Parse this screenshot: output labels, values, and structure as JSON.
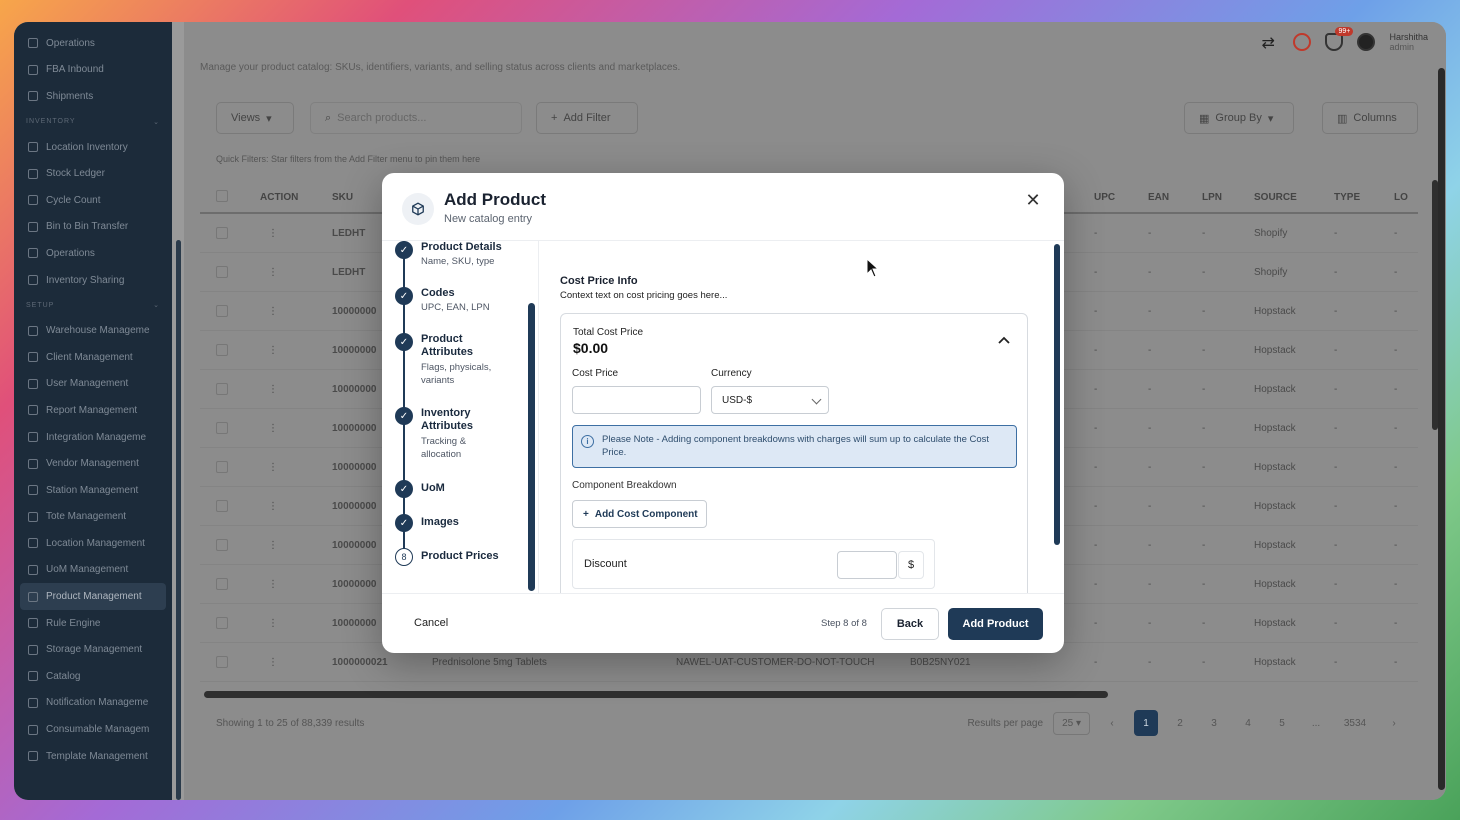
{
  "sidebar": {
    "items_top": [
      "Operations",
      "FBA Inbound",
      "Shipments"
    ],
    "section_inventory": "INVENTORY",
    "items_inventory": [
      "Location Inventory",
      "Stock Ledger",
      "Cycle Count",
      "Bin to Bin Transfer",
      "Operations",
      "Inventory Sharing"
    ],
    "section_setup": "SETUP",
    "items_setup": [
      "Warehouse Manageme",
      "Client Management",
      "User Management",
      "Report Management",
      "Integration Manageme",
      "Vendor Management",
      "Station Management",
      "Tote Management",
      "Location Management",
      "UoM Management",
      "Product Management",
      "Rule Engine",
      "Storage Management",
      "Catalog",
      "Notification Manageme",
      "Consumable Managem",
      "Template Management"
    ]
  },
  "topbar": {
    "user_name": "Harshitha",
    "user_role": "admin",
    "notif_count": "99+"
  },
  "page": {
    "subtitle": "Manage your product catalog: SKUs, identifiers, variants, and selling status across clients and marketplaces.",
    "views_label": "Views",
    "search_placeholder": "Search products...",
    "add_filter_label": "Add Filter",
    "group_by_label": "Group By",
    "columns_label": "Columns",
    "quick_filters": "Quick Filters:  Star filters from the Add Filter menu to pin them here",
    "columns": [
      "ACTION",
      "SKU",
      "UPC",
      "EAN",
      "LPN",
      "SOURCE",
      "TYPE",
      "LO"
    ],
    "rows": [
      {
        "sku": "LEDHT",
        "source": "Shopify"
      },
      {
        "sku": "LEDHT",
        "source": "Shopify"
      },
      {
        "sku": "10000000",
        "source": "Hopstack"
      },
      {
        "sku": "10000000",
        "source": "Hopstack"
      },
      {
        "sku": "10000000",
        "source": "Hopstack"
      },
      {
        "sku": "10000000",
        "source": "Hopstack"
      },
      {
        "sku": "10000000",
        "source": "Hopstack"
      },
      {
        "sku": "10000000",
        "source": "Hopstack"
      },
      {
        "sku": "10000000",
        "source": "Hopstack"
      },
      {
        "sku": "10000000",
        "source": "Hopstack"
      },
      {
        "sku": "10000000",
        "source": "Hopstack"
      },
      {
        "sku": "1000000021",
        "name": "Prednisolone 5mg Tablets",
        "customer": "NAWEL-UAT-CUSTOMER-DO-NOT-TOUCH",
        "asin": "B0B25NY021",
        "source": "Hopstack"
      }
    ],
    "dash": "-",
    "showing": "Showing 1 to 25 of 88,339 results",
    "results_per_page": "Results per page",
    "per_page_value": "25",
    "pages": [
      "1",
      "2",
      "3",
      "4",
      "5",
      "...",
      "3534"
    ]
  },
  "modal": {
    "title": "Add Product",
    "subtitle": "New catalog entry",
    "close_icon": "close-icon",
    "steps": [
      {
        "title": "Product Details",
        "desc": "Name, SKU, type"
      },
      {
        "title": "Codes",
        "desc": "UPC, EAN, LPN"
      },
      {
        "title": "Product Attributes",
        "desc": "Flags, physicals, variants"
      },
      {
        "title": "Inventory Attributes",
        "desc": "Tracking & allocation"
      },
      {
        "title": "UoM",
        "desc": ""
      },
      {
        "title": "Images",
        "desc": ""
      },
      {
        "title": "Product Prices",
        "desc": "",
        "number": "8"
      }
    ],
    "section_title": "Cost Price Info",
    "section_desc": "Context text on cost pricing goes here...",
    "total_cost_label": "Total Cost Price",
    "total_cost_value": "$0.00",
    "cost_price_label": "Cost Price",
    "currency_label": "Currency",
    "currency_value": "USD-$",
    "note": "Please Note - Adding component breakdowns with charges will sum up to calculate the Cost Price.",
    "component_breakdown_label": "Component Breakdown",
    "add_component_label": "Add Cost Component",
    "discount_label": "Discount",
    "discount_unit": "$",
    "cancel_label": "Cancel",
    "step_info": "Step 8 of 8",
    "back_label": "Back",
    "submit_label": "Add Product"
  },
  "colors": {
    "primary": "#1f3a57",
    "note_bg": "#dde8f5",
    "sidebar": "#1c2b3a"
  }
}
